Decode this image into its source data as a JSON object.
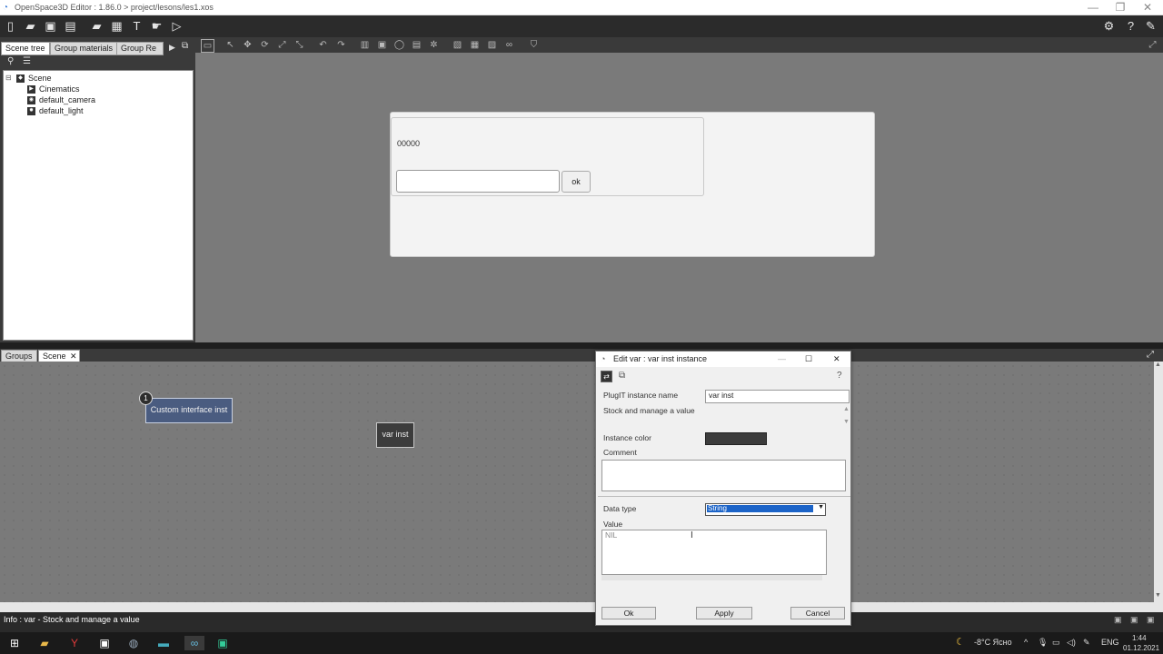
{
  "window": {
    "title": "OpenSpace3D Editor : 1.86.0 > project/lesons/les1.xos",
    "controls": {
      "minimize": "—",
      "restore": "❐",
      "close": "✕"
    }
  },
  "left_tabs": [
    {
      "label": "Scene tree",
      "active": true
    },
    {
      "label": "Group materials",
      "active": false
    },
    {
      "label": "Group Re",
      "active": false
    }
  ],
  "tree": {
    "root": "Scene",
    "children": [
      "Cinematics",
      "default_camera",
      "default_light"
    ]
  },
  "viewport_panel": {
    "counter": "00000",
    "input_value": "",
    "ok_label": "ok"
  },
  "graph_tabs": [
    {
      "label": "Groups"
    },
    {
      "label": "Scene",
      "closable": true
    }
  ],
  "graph_nodes": {
    "custom_interface": {
      "badge": "1",
      "label": "Custom interface inst"
    },
    "var_inst": {
      "label": "var inst"
    }
  },
  "dialog": {
    "title": "Edit var : var inst instance",
    "instance_name_label": "PlugIT instance name",
    "instance_name_value": "var inst",
    "description": "Stock and manage a value",
    "instance_color_label": "Instance color",
    "instance_color": "#3c3c3c",
    "comment_label": "Comment",
    "comment_value": "",
    "data_type_label": "Data type",
    "data_type_value": "String",
    "value_label": "Value",
    "value_text": "NIL",
    "ok_label": "Ok",
    "apply_label": "Apply",
    "cancel_label": "Cancel"
  },
  "info_text": "Info : var - Stock and manage a value",
  "taskbar": {
    "weather": "-8°C Ясно",
    "language": "ENG",
    "time": "1:44",
    "date": "01.12.2021"
  },
  "colors": {
    "node_custom": "#4a5c80",
    "node_var": "#3c3c3c",
    "select_highlight": "#1c64c8"
  }
}
